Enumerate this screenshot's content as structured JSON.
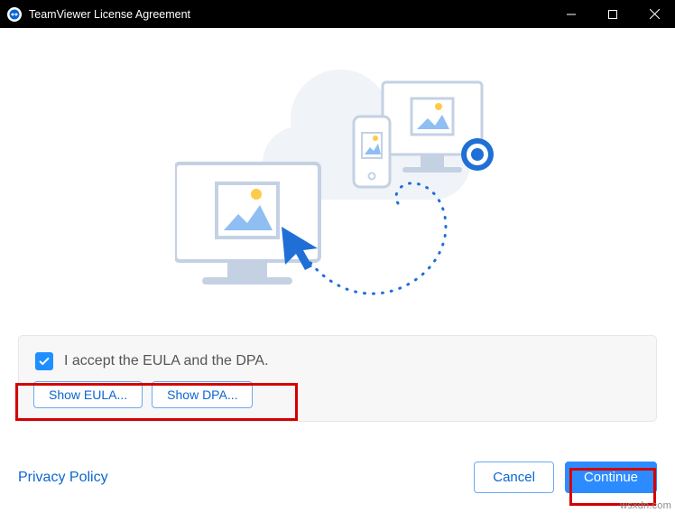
{
  "window": {
    "title": "TeamViewer License Agreement"
  },
  "agreement": {
    "accept_label": "I accept the EULA and the DPA.",
    "show_eula": "Show EULA...",
    "show_dpa": "Show DPA..."
  },
  "footer": {
    "privacy": "Privacy Policy",
    "cancel": "Cancel",
    "continue": "Continue"
  },
  "watermark": "wsxdn.com"
}
